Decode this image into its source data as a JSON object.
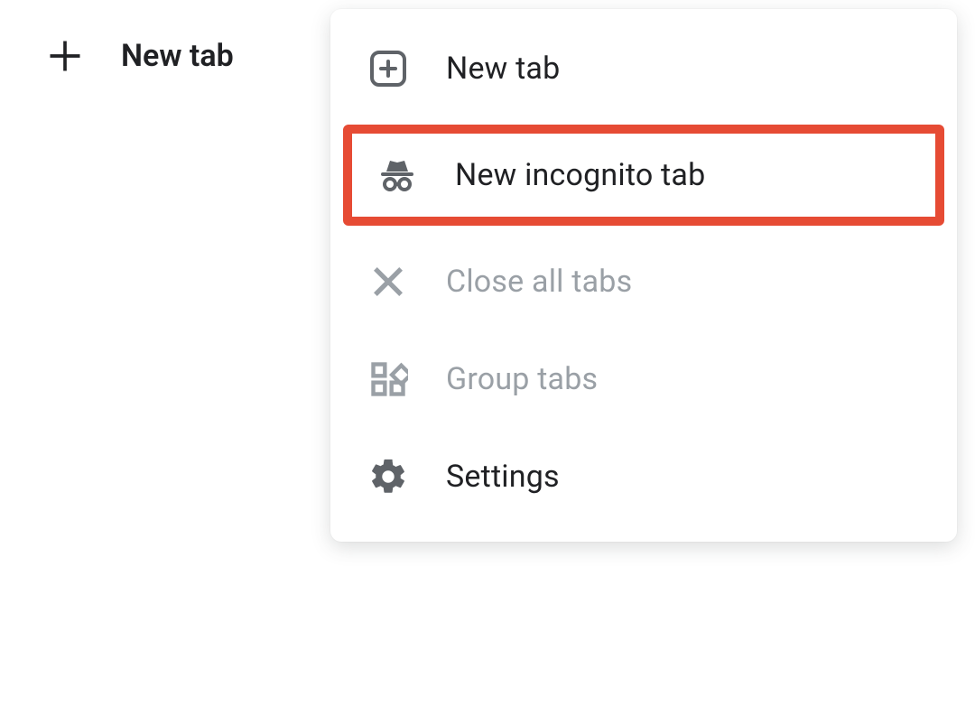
{
  "header": {
    "title": "New tab"
  },
  "menu": {
    "items": [
      {
        "label": "New tab",
        "icon": "plus-box-icon",
        "disabled": false,
        "highlighted": false
      },
      {
        "label": "New incognito tab",
        "icon": "incognito-icon",
        "disabled": false,
        "highlighted": true
      },
      {
        "label": "Close all tabs",
        "icon": "close-icon",
        "disabled": true,
        "highlighted": false
      },
      {
        "label": "Group tabs",
        "icon": "group-tabs-icon",
        "disabled": true,
        "highlighted": false
      },
      {
        "label": "Settings",
        "icon": "gear-icon",
        "disabled": false,
        "highlighted": false
      }
    ]
  }
}
